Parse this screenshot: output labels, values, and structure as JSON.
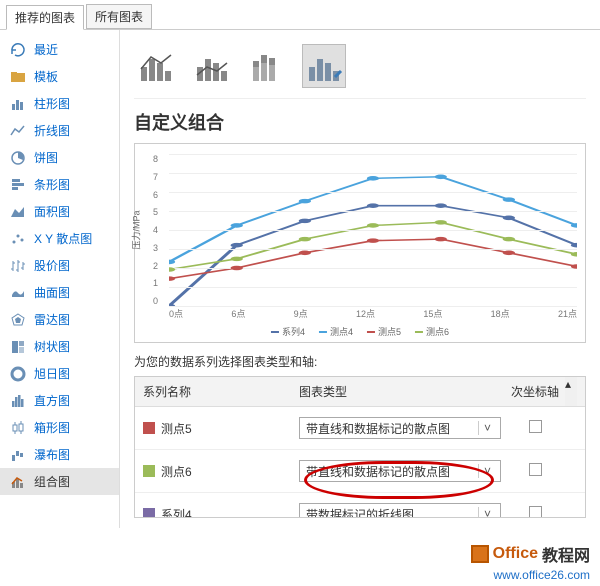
{
  "tabs": {
    "recommended": "推荐的图表",
    "all": "所有图表"
  },
  "sidebar": {
    "items": [
      {
        "label": "最近"
      },
      {
        "label": "模板"
      },
      {
        "label": "柱形图"
      },
      {
        "label": "折线图"
      },
      {
        "label": "饼图"
      },
      {
        "label": "条形图"
      },
      {
        "label": "面积图"
      },
      {
        "label": "X Y 散点图"
      },
      {
        "label": "股价图"
      },
      {
        "label": "曲面图"
      },
      {
        "label": "雷达图"
      },
      {
        "label": "树状图"
      },
      {
        "label": "旭日图"
      },
      {
        "label": "直方图"
      },
      {
        "label": "箱形图"
      },
      {
        "label": "瀑布图"
      },
      {
        "label": "组合图"
      }
    ]
  },
  "content_title": "自定义组合",
  "chart_data": {
    "type": "line",
    "ylabel": "压力/MPa",
    "ylim": [
      0,
      8
    ],
    "y_ticks": [
      8,
      7,
      6,
      5,
      4,
      3,
      2,
      1,
      0
    ],
    "categories": [
      "0点",
      "6点",
      "9点",
      "12点",
      "15点",
      "18点",
      "21点"
    ],
    "series": [
      {
        "name": "系列4",
        "values": [
          0,
          3.2,
          4.5,
          5.3,
          5.3,
          4.6,
          3.2
        ],
        "color": "#5472a8"
      },
      {
        "name": "测点4",
        "values": [
          2.3,
          4.2,
          5.5,
          6.7,
          6.8,
          5.6,
          4.2
        ],
        "color": "#4aa3dd"
      },
      {
        "name": "测点5",
        "values": [
          1.4,
          2.0,
          2.8,
          3.4,
          3.5,
          2.8,
          2.1
        ],
        "color": "#c0504d"
      },
      {
        "name": "测点6",
        "values": [
          1.9,
          2.5,
          3.5,
          4.2,
          4.4,
          3.5,
          2.7
        ],
        "color": "#9bbb59"
      }
    ]
  },
  "combo_label": "为您的数据系列选择图表类型和轴:",
  "grid": {
    "head": {
      "name": "系列名称",
      "type": "图表类型",
      "axis": "次坐标轴"
    },
    "rows": [
      {
        "name": "测点5",
        "type": "带直线和数据标记的散点图",
        "axis": false
      },
      {
        "name": "测点6",
        "type": "带直线和数据标记的散点图",
        "axis": false
      },
      {
        "name": "系列4",
        "type": "带数据标记的折线图",
        "axis": false
      }
    ]
  },
  "footer": {
    "brand1": "Office",
    "brand2": "教程网",
    "url": "www.office26.com"
  }
}
